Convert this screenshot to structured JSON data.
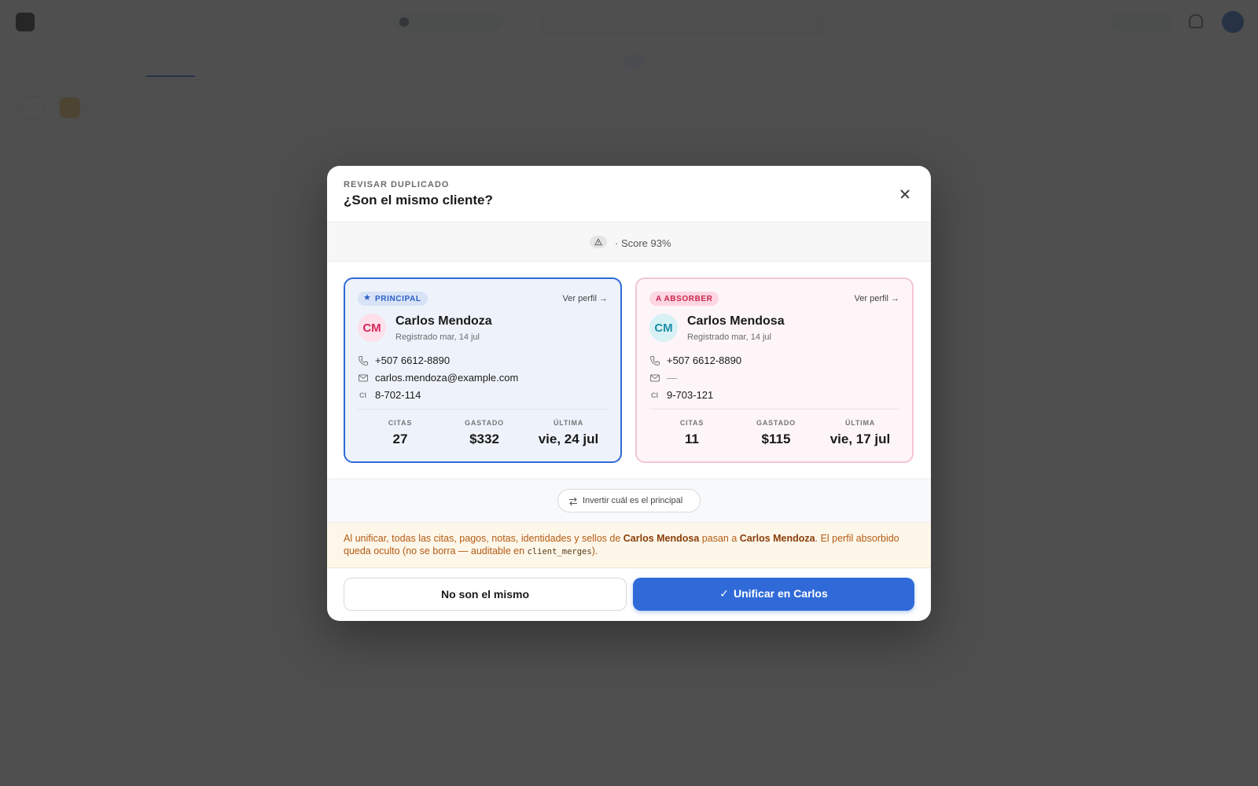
{
  "modal": {
    "eyebrow": "REVISAR DUPLICADO",
    "title": "¿Son el mismo cliente?",
    "score_text": "· Score 93%",
    "swap_label": "Invertir cuál es el principal",
    "notice": {
      "part1": "Al unificar, todas las citas, pagos, notas, identidades y sellos de ",
      "absorbed_name": "Carlos Mendosa",
      "part2": " pasan a ",
      "primary_name": "Carlos Mendoza",
      "part3": ". El perfil absorbido queda oculto (no se borra — auditable en ",
      "code": "client_merges",
      "part4": ")."
    },
    "reject_label": "No son el mismo",
    "merge_label": "Unificar en Carlos",
    "primary": {
      "badge": "PRINCIPAL",
      "profile_link": "Ver perfil →",
      "initials": "CM",
      "name": "Carlos Mendoza",
      "registered": "Registrado mar, 14 jul",
      "phone": "+507 6612-8890",
      "email": "carlos.mendoza@example.com",
      "ci_label": "CI",
      "ci": "8-702-114",
      "stats": [
        {
          "label": "CITAS",
          "value": "27"
        },
        {
          "label": "GASTADO",
          "value": "$332"
        },
        {
          "label": "ÚLTIMA",
          "value": "vie, 24 jul"
        }
      ]
    },
    "absorbed": {
      "badge": "A ABSORBER",
      "profile_link": "Ver perfil →",
      "initials": "CM",
      "name": "Carlos Mendosa",
      "registered": "Registrado mar, 14 jul",
      "phone": "+507 6612-8890",
      "email": "—",
      "ci_label": "CI",
      "ci": "9-703-121",
      "stats": [
        {
          "label": "CITAS",
          "value": "11"
        },
        {
          "label": "GASTADO",
          "value": "$115"
        },
        {
          "label": "ÚLTIMA",
          "value": "vie, 17 jul"
        }
      ]
    }
  },
  "colors": {
    "accent": "#2f6ad8",
    "absorb_accent": "#c8264e",
    "notice_text": "#b45a12"
  }
}
